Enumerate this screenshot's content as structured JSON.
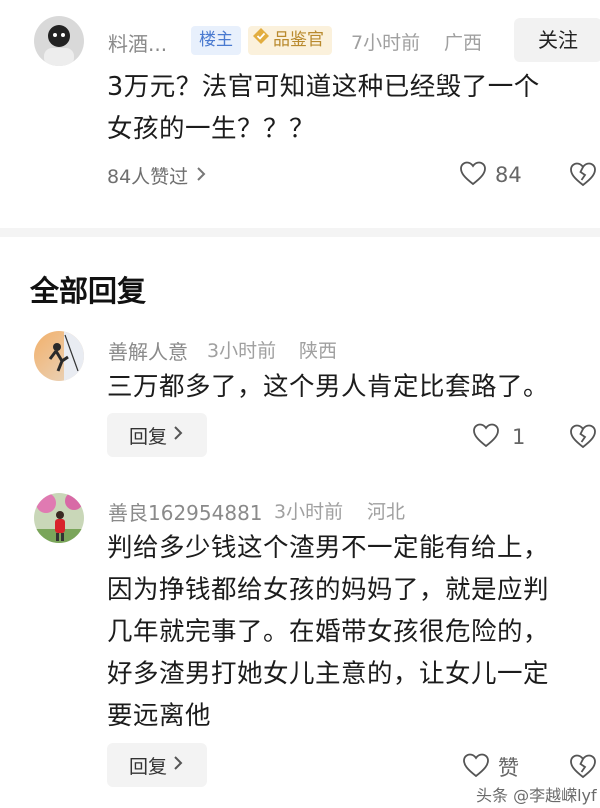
{
  "top_comment": {
    "username": "料酒...",
    "badge_owner": "楼主",
    "badge_judge": "品鉴官",
    "time": "7小时前",
    "location": "广西",
    "follow_label": "关注",
    "text_line1": "3万元？法官可知道这种已经毁了一个",
    "text_line2": "女孩的一生？？？",
    "likes_link": "84人赞过",
    "like_count": "84"
  },
  "replies_section": {
    "title": "全部回复"
  },
  "replies": [
    {
      "username": "善解人意",
      "time": "3小时前",
      "location": "陕西",
      "text_lines": [
        "三万都多了，这个男人肯定比套路了。"
      ],
      "reply_label": "回复",
      "like_count": "1"
    },
    {
      "username": "善良162954881",
      "time": "3小时前",
      "location": "河北",
      "text_lines": [
        "判给多少钱这个渣男不一定能有给上，",
        "因为挣钱都给女孩的妈妈了，就是应判",
        "几年就完事了。在婚带女孩很危险的，",
        "好多渣男打她女儿主意的，让女儿一定",
        "要远离他"
      ],
      "reply_label": "回复",
      "like_label": "赞"
    }
  ],
  "watermark": "头条 @李越嵘lyf",
  "icons": {
    "like": "heart-outline-icon",
    "dislike": "broken-heart-icon",
    "chevron": "chevron-right-icon",
    "judge_badge": "check-diamond-icon"
  },
  "colors": {
    "owner_badge_text": "#4a7ad0",
    "judge_badge_text": "#b98a2e",
    "meta_text": "#a0a0a0"
  }
}
